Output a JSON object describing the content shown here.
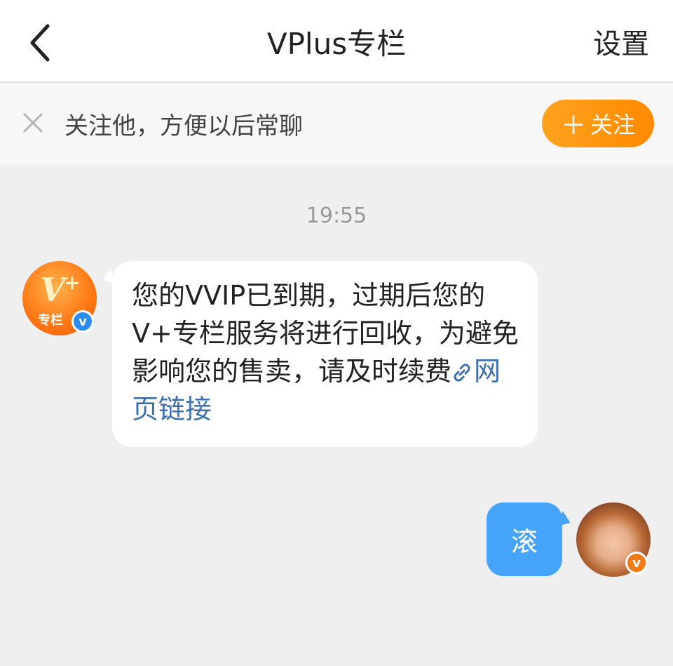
{
  "header": {
    "title": "VPlus专栏",
    "settings_label": "设置"
  },
  "follow_bar": {
    "prompt": "关注他，方便以后常聊",
    "follow_label": "关注"
  },
  "chat": {
    "timestamp": "19:55",
    "incoming": {
      "avatar_text": "专栏",
      "text": "您的VVIP已到期，过期后您的V+专栏服务将进行回收，为避免影响您的售卖，请及时续费",
      "link_text": "网页链接"
    },
    "outgoing": {
      "text": "滚"
    }
  },
  "colors": {
    "accent_orange": "#ff8a00",
    "outgoing_bubble": "#46a5fb",
    "link": "#3a6fb0",
    "verified_blue": "#2c8df0",
    "verified_orange": "#f07a13"
  }
}
